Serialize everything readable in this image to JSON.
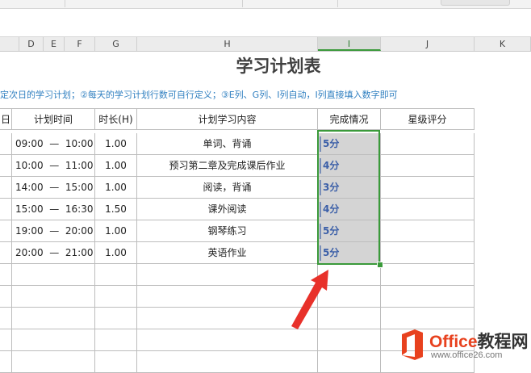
{
  "sheet": {
    "title": "学习计划表",
    "note": "定次日的学习计划；②每天的学习计划行数可自行定义；③E列、G列、I列自动，I列直接填入数字即可",
    "column_headers": [
      "D",
      "E",
      "F",
      "G",
      "H",
      "I",
      "J",
      "K"
    ],
    "active_column": "I",
    "table_headers": {
      "partial_col": "日",
      "plan_time": "计划时间",
      "duration": "时长(H)",
      "content": "计划学习内容",
      "status": "完成情况",
      "rating": "星级评分"
    },
    "rows": [
      {
        "start": "09:00",
        "dash": "—",
        "end": "10:00",
        "duration": "1.00",
        "content": "单词、背诵",
        "status": "5分"
      },
      {
        "start": "10:00",
        "dash": "—",
        "end": "11:00",
        "duration": "1.00",
        "content": "预习第二章及完成课后作业",
        "status": "4分"
      },
      {
        "start": "14:00",
        "dash": "—",
        "end": "15:00",
        "duration": "1.00",
        "content": "阅读，背诵",
        "status": "3分"
      },
      {
        "start": "15:00",
        "dash": "—",
        "end": "16:30",
        "duration": "1.50",
        "content": "课外阅读",
        "status": "4分"
      },
      {
        "start": "19:00",
        "dash": "—",
        "end": "20:00",
        "duration": "1.00",
        "content": "钢琴练习",
        "status": "5分"
      },
      {
        "start": "20:00",
        "dash": "—",
        "end": "21:00",
        "duration": "1.00",
        "content": "英语作业",
        "status": "5分"
      }
    ],
    "selection_color": "#3a9a3a",
    "status_text_color": "#3b5fa8",
    "note_color": "#2f7fc0"
  },
  "annotation": {
    "arrow_color": "#e8312a",
    "icon": "red-arrow-icon"
  },
  "watermark": {
    "name_accent": "Office",
    "name_rest": "教程网",
    "url": "www.office26.com",
    "icon": "office-logo-icon"
  }
}
